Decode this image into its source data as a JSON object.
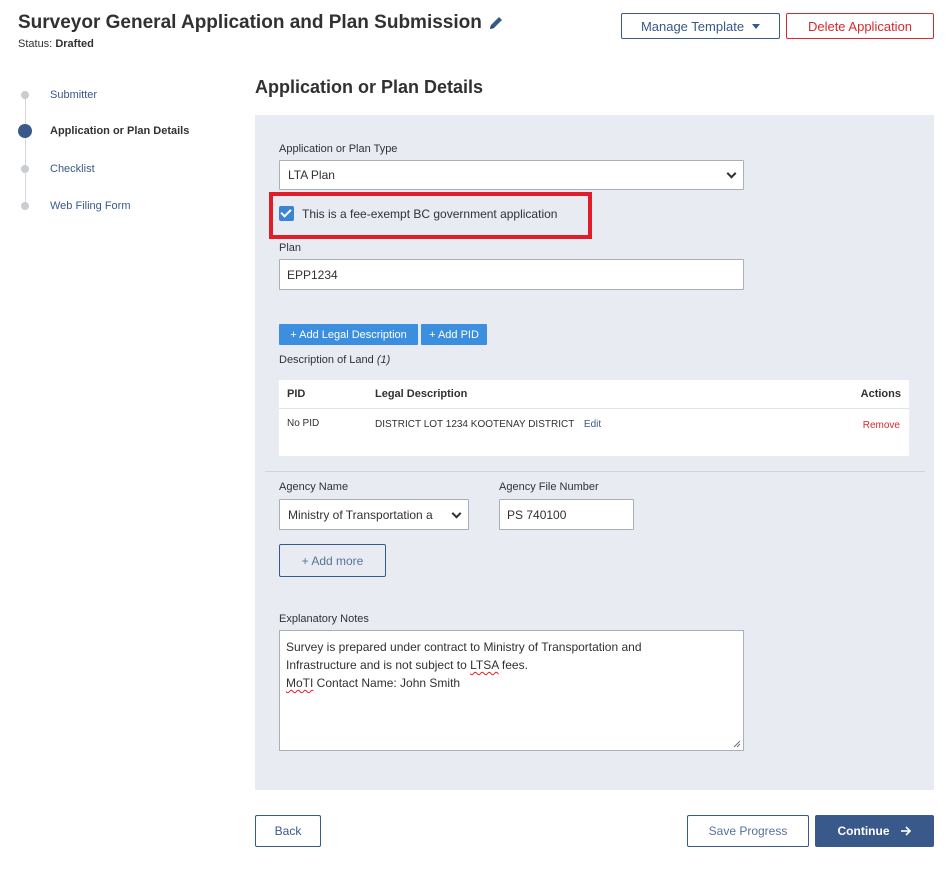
{
  "header": {
    "title": "Surveyor General Application and Plan Submission",
    "status_label": "Status:",
    "status_value": "Drafted",
    "manage_template": "Manage Template",
    "delete_application": "Delete Application"
  },
  "stepper": {
    "items": [
      {
        "label": "Submitter",
        "active": false
      },
      {
        "label": "Application or Plan Details",
        "active": true
      },
      {
        "label": "Checklist",
        "active": false
      },
      {
        "label": "Web Filing Form",
        "active": false
      }
    ]
  },
  "form": {
    "section_title": "Application or Plan Details",
    "plan_type_label": "Application or Plan Type",
    "plan_type_value": "LTA Plan",
    "fee_exempt_label": "This is a fee-exempt BC government application",
    "fee_exempt_checked": true,
    "plan_label": "Plan",
    "plan_value": "EPP1234",
    "add_legal_description": "+ Add Legal Description",
    "add_pid": "+ Add PID",
    "description_of_land_label": "Description of Land",
    "description_count": "(1)",
    "table": {
      "headers": [
        "PID",
        "Legal Description",
        "Actions"
      ],
      "rows": [
        {
          "pid": "No PID",
          "legal_description": "DISTRICT LOT 1234 KOOTENAY DISTRICT",
          "edit": "Edit",
          "remove": "Remove"
        }
      ]
    },
    "agency_name_label": "Agency Name",
    "agency_name_value": "Ministry of Transportation a",
    "agency_file_number_label": "Agency File Number",
    "agency_file_number_value": "PS 740100",
    "add_more": "+ Add more",
    "explanatory_notes_label": "Explanatory Notes",
    "notes_line1": "Survey is prepared under contract to Ministry of Transportation and",
    "notes_line2_a": "Infrastructure and is not subject to ",
    "notes_line2_b": "LTSA",
    "notes_line2_c": " fees.",
    "notes_line3_a": "MoTI",
    "notes_line3_b": " Contact Name:  John Smith"
  },
  "footer": {
    "back": "Back",
    "save_progress": "Save Progress",
    "continue": "Continue"
  },
  "colors": {
    "primary": "#38598a",
    "danger": "#d8292f",
    "accent_blue": "#3b8fde",
    "panel_bg": "#e8ecf2",
    "highlight": "#e11d2a"
  }
}
